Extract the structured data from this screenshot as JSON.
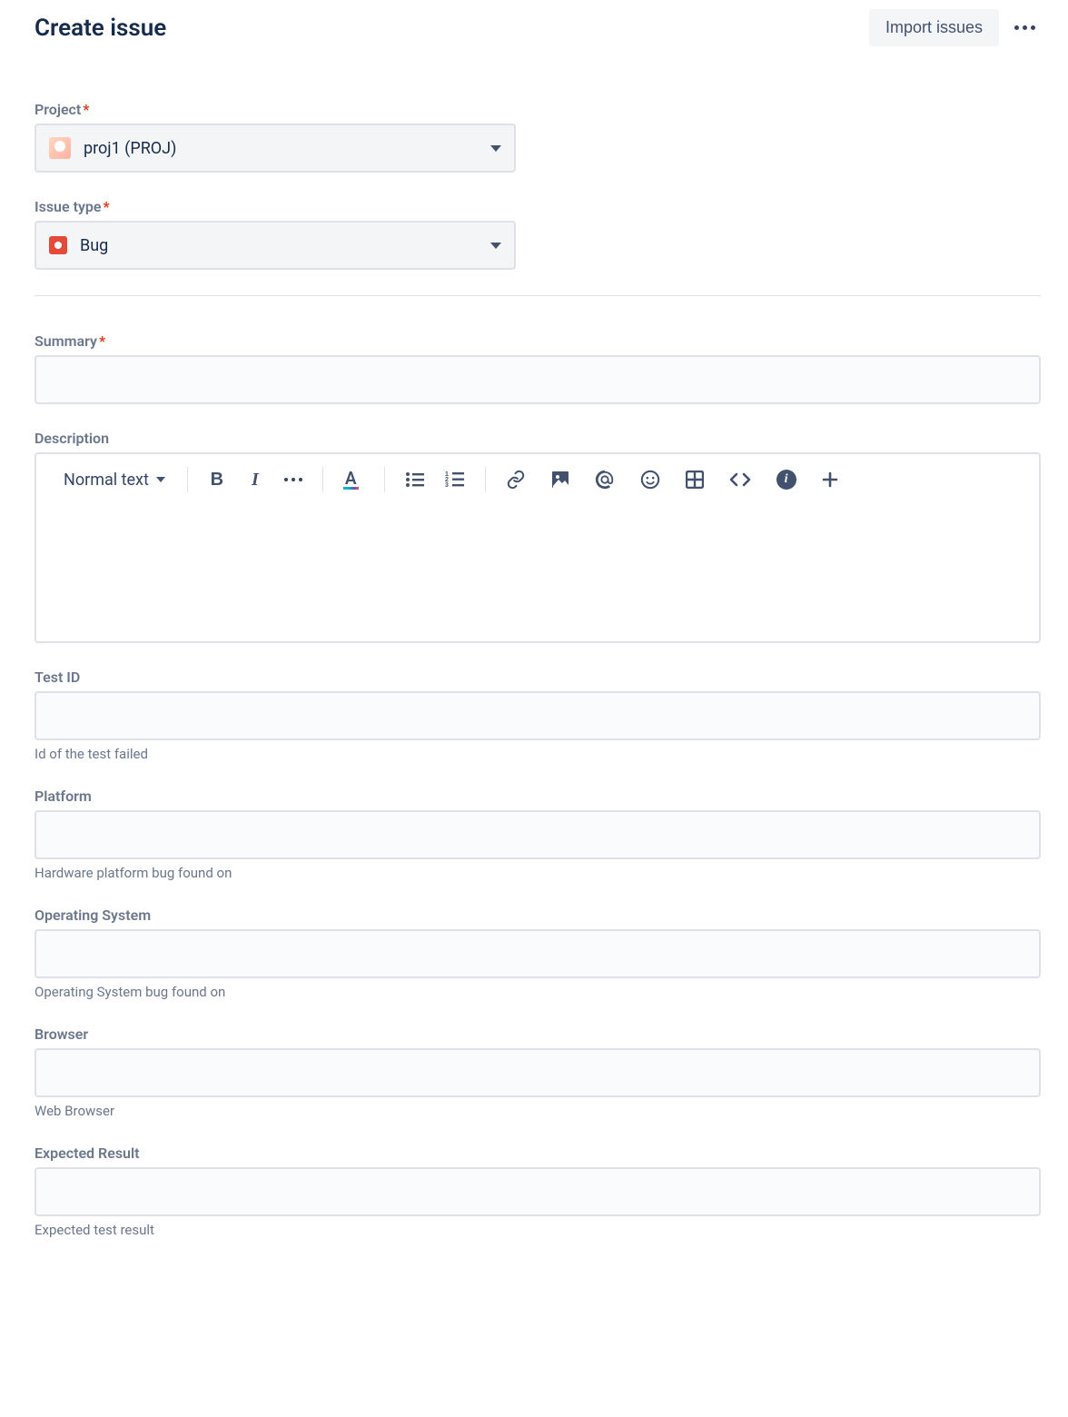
{
  "header": {
    "title": "Create issue",
    "import_label": "Import issues"
  },
  "project": {
    "label": "Project",
    "value": "proj1 (PROJ)"
  },
  "issue_type": {
    "label": "Issue type",
    "value": "Bug"
  },
  "summary": {
    "label": "Summary"
  },
  "description": {
    "label": "Description",
    "text_style": "Normal text"
  },
  "fields": {
    "test_id": {
      "label": "Test ID",
      "help": "Id of the test failed"
    },
    "platform": {
      "label": "Platform",
      "help": "Hardware platform bug found on"
    },
    "os": {
      "label": "Operating System",
      "help": "Operating System bug found on"
    },
    "browser": {
      "label": "Browser",
      "help": "Web Browser"
    },
    "expected": {
      "label": "Expected Result",
      "help": "Expected test result"
    }
  }
}
